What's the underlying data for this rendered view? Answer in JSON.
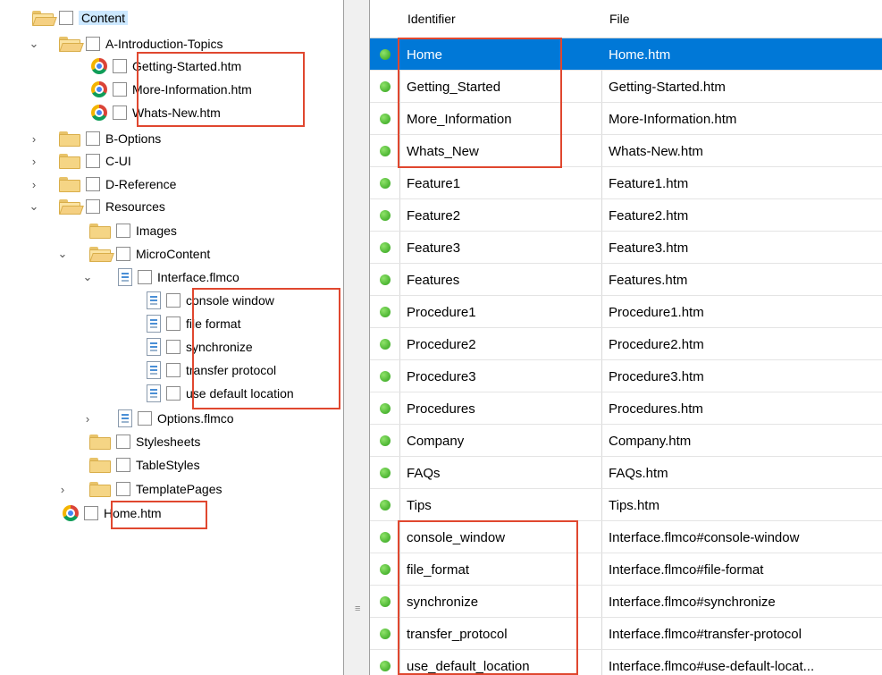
{
  "tree": {
    "content": "Content",
    "a_intro": "A-Introduction-Topics",
    "getting_started": "Getting-Started.htm",
    "more_info": "More-Information.htm",
    "whats_new": "Whats-New.htm",
    "b_options": "B-Options",
    "c_ui": "C-UI",
    "d_reference": "D-Reference",
    "resources": "Resources",
    "images": "Images",
    "microcontent": "MicroContent",
    "interface": "Interface.flmco",
    "console_window": "console window",
    "file_format": "file format",
    "synchronize": "synchronize",
    "transfer_protocol": "transfer protocol",
    "use_default_location": "use default location",
    "options_flmco": "Options.flmco",
    "stylesheets": "Stylesheets",
    "tablestyles": "TableStyles",
    "templatepages": "TemplatePages",
    "home": "Home.htm"
  },
  "table": {
    "headers": {
      "identifier": "Identifier",
      "file": "File"
    },
    "rows": [
      {
        "id": "Home",
        "file": "Home.htm"
      },
      {
        "id": "Getting_Started",
        "file": "Getting-Started.htm"
      },
      {
        "id": "More_Information",
        "file": "More-Information.htm"
      },
      {
        "id": "Whats_New",
        "file": "Whats-New.htm"
      },
      {
        "id": "Feature1",
        "file": "Feature1.htm"
      },
      {
        "id": "Feature2",
        "file": "Feature2.htm"
      },
      {
        "id": "Feature3",
        "file": "Feature3.htm"
      },
      {
        "id": "Features",
        "file": "Features.htm"
      },
      {
        "id": "Procedure1",
        "file": "Procedure1.htm"
      },
      {
        "id": "Procedure2",
        "file": "Procedure2.htm"
      },
      {
        "id": "Procedure3",
        "file": "Procedure3.htm"
      },
      {
        "id": "Procedures",
        "file": "Procedures.htm"
      },
      {
        "id": "Company",
        "file": "Company.htm"
      },
      {
        "id": "FAQs",
        "file": "FAQs.htm"
      },
      {
        "id": "Tips",
        "file": "Tips.htm"
      },
      {
        "id": "console_window",
        "file": "Interface.flmco#console-window"
      },
      {
        "id": "file_format",
        "file": "Interface.flmco#file-format"
      },
      {
        "id": "synchronize",
        "file": "Interface.flmco#synchronize"
      },
      {
        "id": "transfer_protocol",
        "file": "Interface.flmco#transfer-protocol"
      },
      {
        "id": "use_default_location",
        "file": "Interface.flmco#use-default-locat..."
      }
    ]
  },
  "splitter_grip": "≡",
  "colors": {
    "selection": "#0078d7",
    "highlight_box": "#e0472f",
    "status_dot": "#3cb521"
  }
}
